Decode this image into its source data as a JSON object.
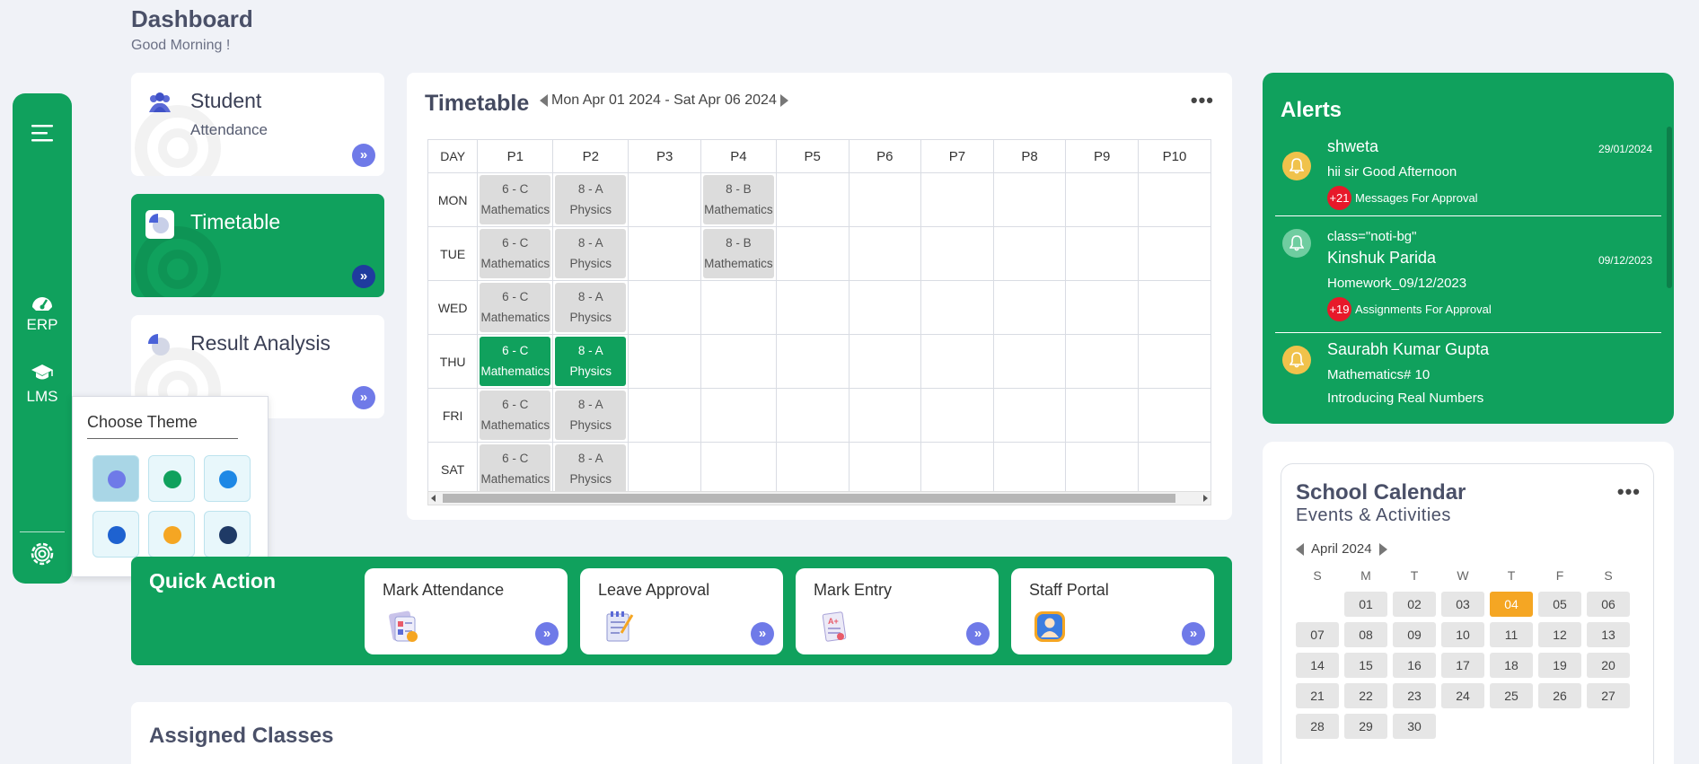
{
  "header": {
    "title": "Dashboard",
    "greeting": "Good Morning !"
  },
  "rail": {
    "items": [
      {
        "label": "ERP",
        "icon": "dashboard-gauge-icon"
      },
      {
        "label": "LMS",
        "icon": "graduation-cap-icon"
      }
    ],
    "menu_icon": "hamburger-menu-icon",
    "settings_icon": "gear-icon"
  },
  "quick_cards": [
    {
      "title": "Student",
      "subtitle": "Attendance",
      "icon": "users-icon"
    },
    {
      "title": "Timetable",
      "subtitle": "",
      "icon": "pie-chart-icon",
      "active": true
    },
    {
      "title": "Result Analysis",
      "subtitle": "",
      "icon": "pie-chart-icon"
    }
  ],
  "theme_picker": {
    "title": "Choose Theme",
    "swatches": [
      "#6f7ae8",
      "#10a15d",
      "#1e88e5",
      "#1e62d0",
      "#f5a623",
      "#1f3a66"
    ],
    "selected_index": 0
  },
  "timetable": {
    "title": "Timetable",
    "range": "Mon Apr 01 2024 - Sat Apr 06 2024",
    "columns": [
      "DAY",
      "P1",
      "P2",
      "P3",
      "P4",
      "P5",
      "P6",
      "P7",
      "P8",
      "P9",
      "P10"
    ],
    "rows": [
      {
        "day": "MON",
        "cells": [
          {
            "cls": "6 - C",
            "sub": "Mathematics"
          },
          {
            "cls": "8 - A",
            "sub": "Physics"
          },
          null,
          {
            "cls": "8 - B",
            "sub": "Mathematics"
          },
          null,
          null,
          null,
          null,
          null,
          null
        ]
      },
      {
        "day": "TUE",
        "cells": [
          {
            "cls": "6 - C",
            "sub": "Mathematics"
          },
          {
            "cls": "8 - A",
            "sub": "Physics"
          },
          null,
          {
            "cls": "8 - B",
            "sub": "Mathematics"
          },
          null,
          null,
          null,
          null,
          null,
          null
        ]
      },
      {
        "day": "WED",
        "cells": [
          {
            "cls": "6 - C",
            "sub": "Mathematics"
          },
          {
            "cls": "8 - A",
            "sub": "Physics"
          },
          null,
          null,
          null,
          null,
          null,
          null,
          null,
          null
        ]
      },
      {
        "day": "THU",
        "highlight": true,
        "cells": [
          {
            "cls": "6 - C",
            "sub": "Mathematics"
          },
          {
            "cls": "8 - A",
            "sub": "Physics"
          },
          null,
          null,
          null,
          null,
          null,
          null,
          null,
          null
        ]
      },
      {
        "day": "FRI",
        "cells": [
          {
            "cls": "6 - C",
            "sub": "Mathematics"
          },
          {
            "cls": "8 - A",
            "sub": "Physics"
          },
          null,
          null,
          null,
          null,
          null,
          null,
          null,
          null
        ]
      },
      {
        "day": "SAT",
        "cells": [
          {
            "cls": "6 - C",
            "sub": "Mathematics"
          },
          {
            "cls": "8 - A",
            "sub": "Physics"
          },
          null,
          null,
          null,
          null,
          null,
          null,
          null,
          null
        ]
      }
    ]
  },
  "quick_action": {
    "title": "Quick Action",
    "items": [
      {
        "label": "Mark Attendance",
        "icon": "attendance-clipboard-icon"
      },
      {
        "label": "Leave Approval",
        "icon": "leave-notepad-icon"
      },
      {
        "label": "Mark Entry",
        "icon": "marks-sheet-icon"
      },
      {
        "label": "Staff Portal",
        "icon": "staff-portal-icon"
      }
    ]
  },
  "assigned": {
    "title": "Assigned Classes"
  },
  "alerts": {
    "title": "Alerts",
    "items": [
      {
        "name": "shweta",
        "date": "29/01/2024",
        "message": "hii sir Good Afternoon",
        "badge_count": "+21",
        "badge_text": "Messages For Approval"
      },
      {
        "prefix": "class=\"noti-bg\"",
        "name": "Kinshuk Parida",
        "date": "09/12/2023",
        "message": "Homework_09/12/2023",
        "badge_count": "+19",
        "badge_text": "Assignments For Approval"
      },
      {
        "name": "Saurabh Kumar Gupta",
        "message": "Mathematics# 10",
        "extra": "Introducing Real Numbers"
      }
    ]
  },
  "calendar": {
    "title": "School Calendar",
    "subtitle": "Events & Activities",
    "month": "April 2024",
    "weekdays": [
      "S",
      "M",
      "T",
      "W",
      "T",
      "F",
      "S"
    ],
    "days": [
      "01",
      "02",
      "03",
      "04",
      "05",
      "06",
      "07",
      "08",
      "09",
      "10",
      "11",
      "12",
      "13",
      "14",
      "15",
      "16",
      "17",
      "18",
      "19",
      "20",
      "21",
      "22",
      "23",
      "24",
      "25",
      "26",
      "27",
      "28",
      "29",
      "30"
    ],
    "first_day_offset": 1,
    "today": "04"
  },
  "colors": {
    "primary": "#10a15d",
    "accent_button": "#6f7ae8",
    "today": "#f5a623",
    "badge": "#e7192a"
  }
}
